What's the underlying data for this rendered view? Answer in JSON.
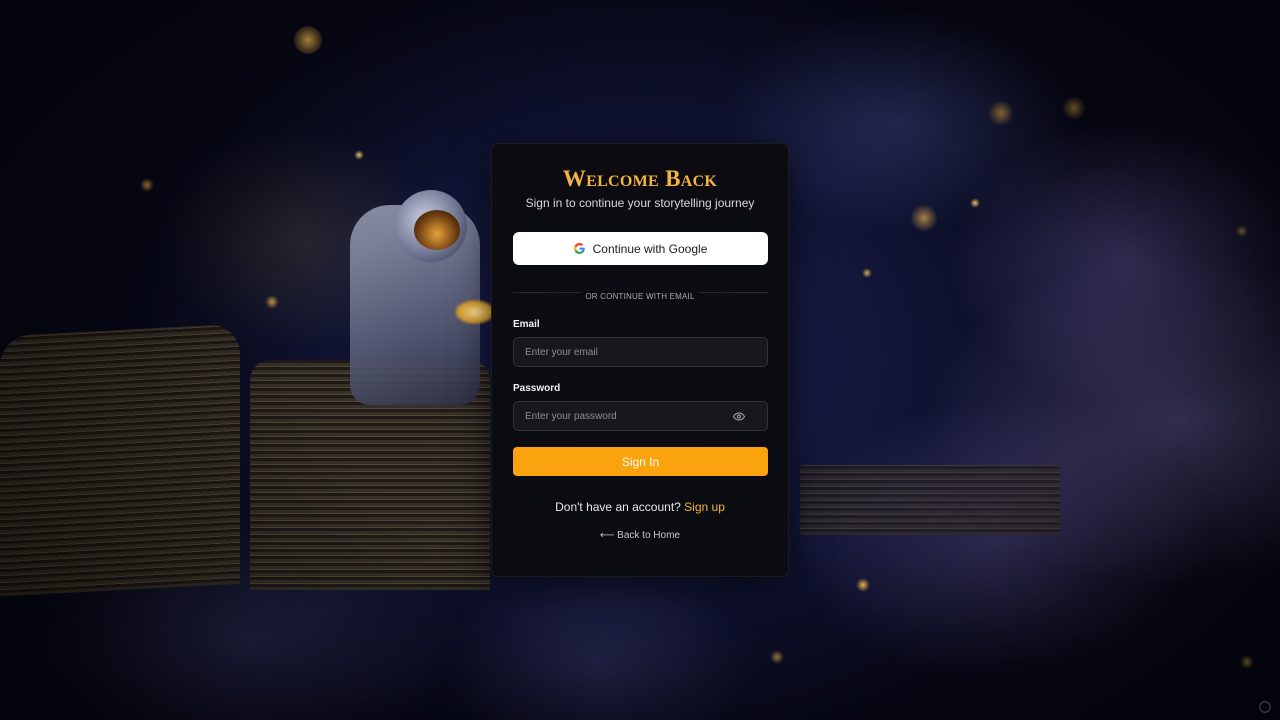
{
  "card": {
    "title": "Welcome Back",
    "subtitle": "Sign in to continue your storytelling journey"
  },
  "google": {
    "label": "Continue with Google",
    "icon": "google-g-icon"
  },
  "divider": {
    "text": "OR CONTINUE WITH EMAIL"
  },
  "email": {
    "label": "Email",
    "placeholder": "Enter your email",
    "value": ""
  },
  "password": {
    "label": "Password",
    "placeholder": "Enter your password",
    "value": "",
    "toggle_icon": "eye-icon"
  },
  "signin": {
    "label": "Sign In"
  },
  "signup": {
    "prompt": "Don't have an account?",
    "link": "Sign up"
  },
  "back": {
    "arrow": "⟵",
    "label": "Back to Home"
  },
  "colors": {
    "accent": "#fba30f",
    "title": "#f3b53f",
    "card_bg": "#0b0b10",
    "link": "#f4b23e"
  }
}
